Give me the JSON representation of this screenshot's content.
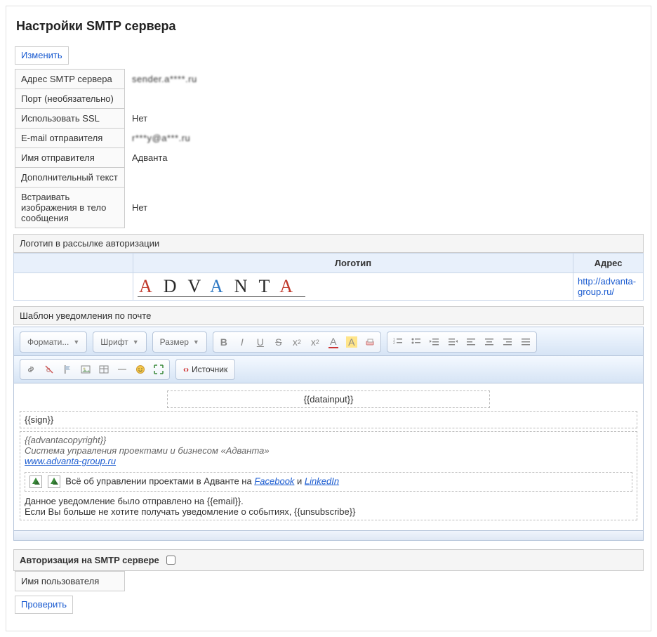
{
  "page_title": "Настройки SMTP сервера",
  "buttons": {
    "edit": "Изменить",
    "check": "Проверить"
  },
  "fields": {
    "smtp_address": {
      "label": "Адрес SMTP сервера",
      "value": "sender.a****.ru"
    },
    "port": {
      "label": "Порт (необязательно)",
      "value": ""
    },
    "use_ssl": {
      "label": "Использовать SSL",
      "value": "Нет"
    },
    "sender_email": {
      "label": "E-mail отправителя",
      "value": "r***y@a***.ru"
    },
    "sender_name": {
      "label": "Имя отправителя",
      "value": "Адванта"
    },
    "extra_text": {
      "label": "Дополнительный текст",
      "value": ""
    },
    "embed_images": {
      "label": "Встраивать изображения в тело сообщения",
      "value": "Нет"
    }
  },
  "logo_section": {
    "title": "Логотип в рассылке авторизации",
    "columns": {
      "logo": "Логотип",
      "address": "Адрес"
    },
    "address_url": "http://advanta-group.ru/",
    "wordmark": "ADVANTA"
  },
  "template_section_title": "Шаблон уведомления по почте",
  "toolbar": {
    "format": "Формати...",
    "font": "Шрифт",
    "size": "Размер",
    "source": "Источник"
  },
  "editor": {
    "datainput": "{{datainput}}",
    "sign": "{{sign}}",
    "copyright": "{{advantacopyright}}",
    "system_line": "Система управления проектами и бизнесом «Адванта»",
    "site_link": "www.advanta-group.ru",
    "social_prefix": "Всё об управлении проектами в Адванте на ",
    "fb": "Facebook",
    "and": " и ",
    "li": "LinkedIn",
    "sent_to": "Данное уведомление было отправлено на {{email}}.",
    "unsubscribe": "Если Вы больше не хотите получать уведомление о событиях, {{unsubscribe}}"
  },
  "auth": {
    "title": "Авторизация на SMTP сервере",
    "username_label": "Имя пользователя"
  }
}
